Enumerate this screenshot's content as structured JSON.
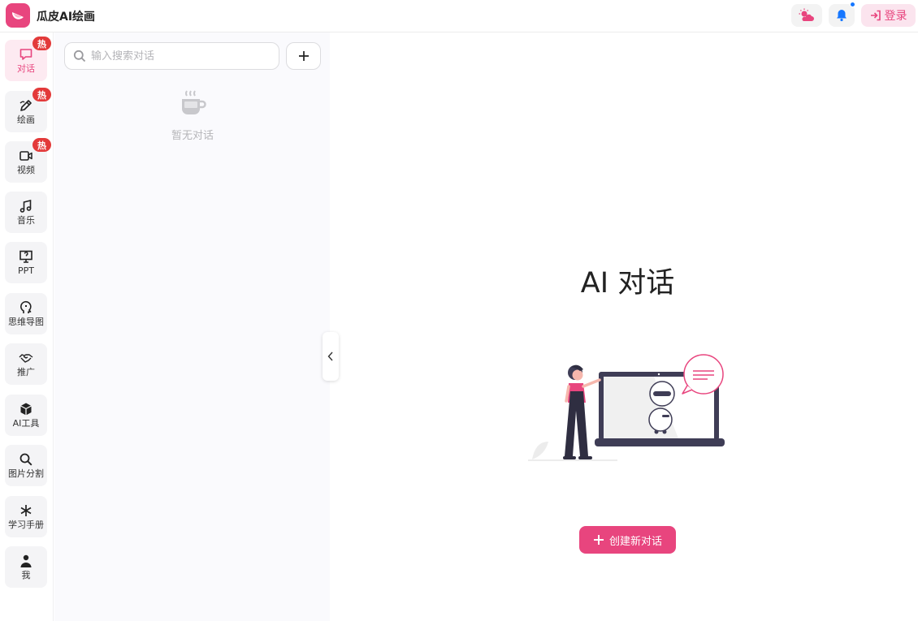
{
  "app": {
    "title": "瓜皮AI绘画"
  },
  "header": {
    "login_label": "登录"
  },
  "nav": {
    "hot_label": "热",
    "items": [
      {
        "label": "对话",
        "icon": "chat-icon",
        "hot": true,
        "active": true
      },
      {
        "label": "绘画",
        "icon": "pen-icon",
        "hot": true
      },
      {
        "label": "视频",
        "icon": "video-icon",
        "hot": true
      },
      {
        "label": "音乐",
        "icon": "music-icon"
      },
      {
        "label": "PPT",
        "icon": "presentation-icon"
      },
      {
        "label": "思维导图",
        "icon": "mind-map-icon"
      },
      {
        "label": "推广",
        "icon": "handshake-icon"
      },
      {
        "label": "AI工具",
        "icon": "box-icon"
      },
      {
        "label": "图片分割",
        "icon": "search-icon"
      },
      {
        "label": "学习手册",
        "icon": "asterisk-icon"
      },
      {
        "label": "我",
        "icon": "user-icon"
      }
    ]
  },
  "sidebar": {
    "search_placeholder": "输入搜索对话",
    "empty_text": "暂无对话"
  },
  "main": {
    "title": "AI 对话",
    "create_label": "创建新对话"
  },
  "colors": {
    "accent": "#e8457e",
    "hot_badge": "#e33a3a",
    "notify_dot": "#1677ff"
  }
}
